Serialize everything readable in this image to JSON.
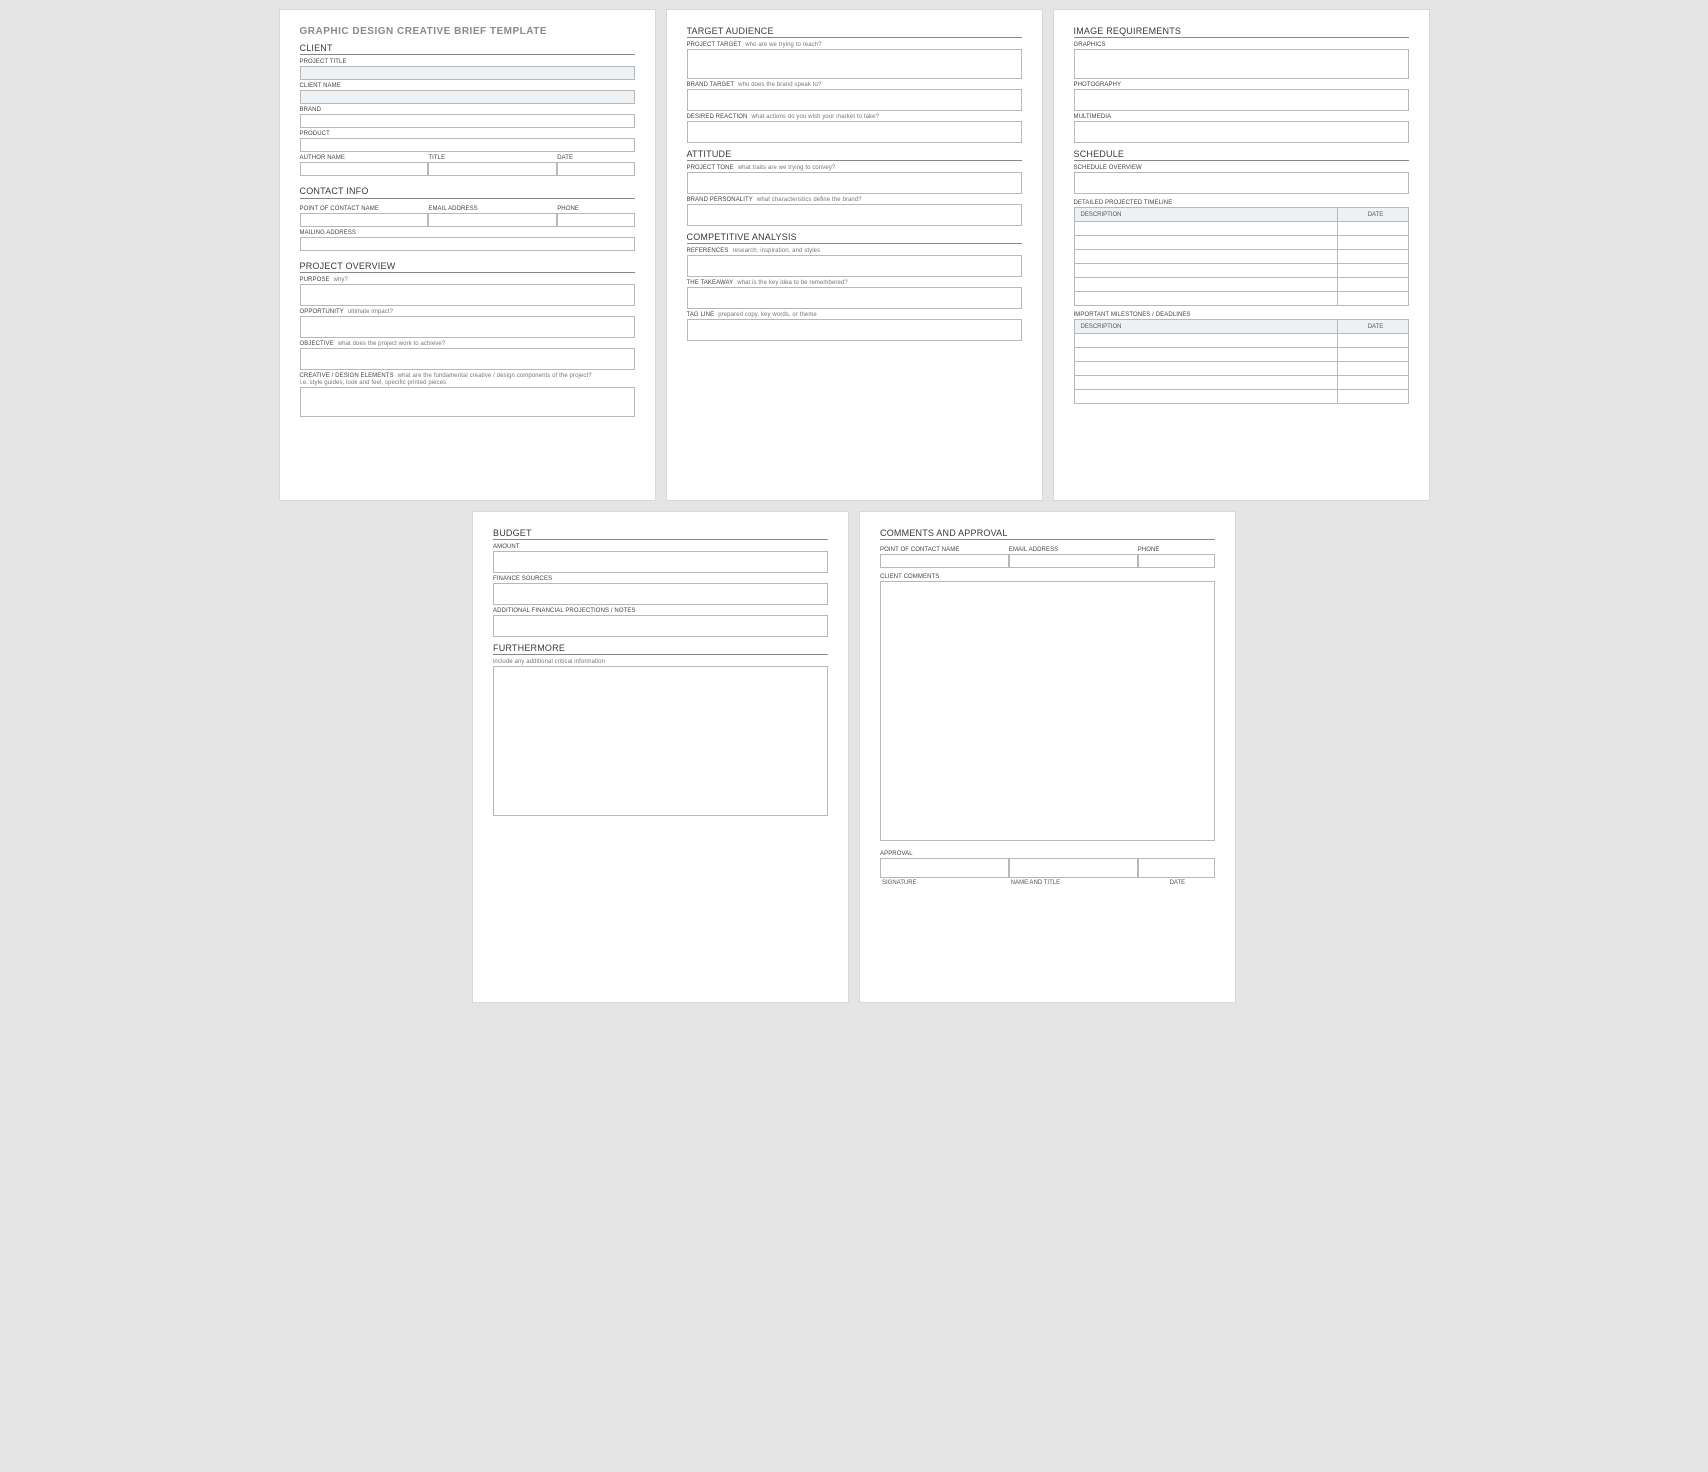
{
  "title": "GRAPHIC DESIGN CREATIVE BRIEF TEMPLATE",
  "p1": {
    "s_client": "CLIENT",
    "project_title": "PROJECT TITLE",
    "client_name": "CLIENT NAME",
    "brand": "BRAND",
    "product": "PRODUCT",
    "author_name": "AUTHOR NAME",
    "title_lbl": "TITLE",
    "date": "DATE",
    "s_contact": "CONTACT INFO",
    "poc": "POINT OF CONTACT NAME",
    "email": "EMAIL ADDRESS",
    "phone": "PHONE",
    "mailing": "MAILING ADDRESS",
    "s_overview": "PROJECT OVERVIEW",
    "purpose": "PURPOSE",
    "purpose_h": "why?",
    "opportunity": "OPPORTUNITY",
    "opportunity_h": "ultimate impact?",
    "objective": "OBJECTIVE",
    "objective_h": "what does the project work to achieve?",
    "creative": "CREATIVE / DESIGN ELEMENTS",
    "creative_h": "what are the fundamental creative / design components of the project?",
    "creative_h2": "i.e. style guides, look and feel, specific printed pieces"
  },
  "p2": {
    "s_target": "TARGET AUDIENCE",
    "ptarget": "PROJECT TARGET",
    "ptarget_h": "who are we trying to reach?",
    "btarget": "BRAND TARGET",
    "btarget_h": "who does the brand speak to?",
    "reaction": "DESIRED REACTION",
    "reaction_h": "what actions do you wish your market to take?",
    "s_attitude": "ATTITUDE",
    "tone": "PROJECT TONE",
    "tone_h": "what traits are we trying to convey?",
    "personality": "BRAND PERSONALITY",
    "personality_h": "what characteristics define the brand?",
    "s_comp": "COMPETITIVE ANALYSIS",
    "refs": "REFERENCES",
    "refs_h": "research, inspiration, and styles",
    "takeaway": "THE TAKEAWAY",
    "takeaway_h": "what is the key idea to be remembered?",
    "tagline": "TAG LINE",
    "tagline_h": "prepared copy, key words, or theme"
  },
  "p3": {
    "s_image": "IMAGE REQUIREMENTS",
    "graphics": "GRAPHICS",
    "photo": "PHOTOGRAPHY",
    "multi": "MULTIMEDIA",
    "s_schedule": "SCHEDULE",
    "overview": "SCHEDULE OVERVIEW",
    "detailed": "DETAILED PROJECTED TIMELINE",
    "desc": "DESCRIPTION",
    "date": "DATE",
    "milestones": "IMPORTANT MILESTONES / DEADLINES"
  },
  "p4": {
    "s_budget": "BUDGET",
    "amount": "AMOUNT",
    "sources": "FINANCE SOURCES",
    "notes": "ADDITIONAL FINANCIAL PROJECTIONS / NOTES",
    "s_further": "FURTHERMORE",
    "further_h": "include any additional critical information"
  },
  "p5": {
    "s_comments": "COMMENTS AND APPROVAL",
    "poc": "POINT OF CONTACT NAME",
    "email": "EMAIL ADDRESS",
    "phone": "PHONE",
    "client_comments": "CLIENT COMMENTS",
    "approval": "APPROVAL",
    "signature": "SIGNATURE",
    "nametitle": "NAME AND TITLE",
    "date": "DATE"
  }
}
